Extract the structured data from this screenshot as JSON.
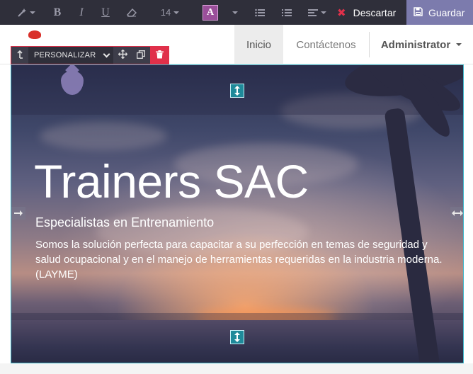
{
  "toolbar": {
    "font_size": "14",
    "bold_label": "B",
    "italic_label": "I",
    "underline_label": "U",
    "color_label": "A",
    "discard_label": "Descartar",
    "save_label": "Guardar",
    "icons": [
      "magic-wand-icon",
      "eraser-icon",
      "unordered-list-icon",
      "ordered-list-icon",
      "align-left-icon",
      "close-icon",
      "floppy-disk-icon"
    ]
  },
  "navbar": {
    "items": [
      {
        "label": "Inicio",
        "active": true
      },
      {
        "label": "Contáctenos",
        "active": false
      }
    ],
    "user_label": "Administrator"
  },
  "snippet_options": {
    "customize_label": "PERSONALIZAR"
  },
  "hero": {
    "title": "Trainers SAC",
    "subtitle": "Especialistas en Entrenamiento",
    "description": "Somos la solución perfecta para capacitar a su perfección en temas de seguridad y salud ocupacional y en el manejo de herramientas requeridas en la industria moderna. (LAYME)"
  },
  "colors": {
    "toolbar_bg": "#2f2f3a",
    "save_bg": "#7c7bad",
    "danger": "#e0304a",
    "handle": "#1f8a9a",
    "selection_outline": "#3fb6c9"
  }
}
